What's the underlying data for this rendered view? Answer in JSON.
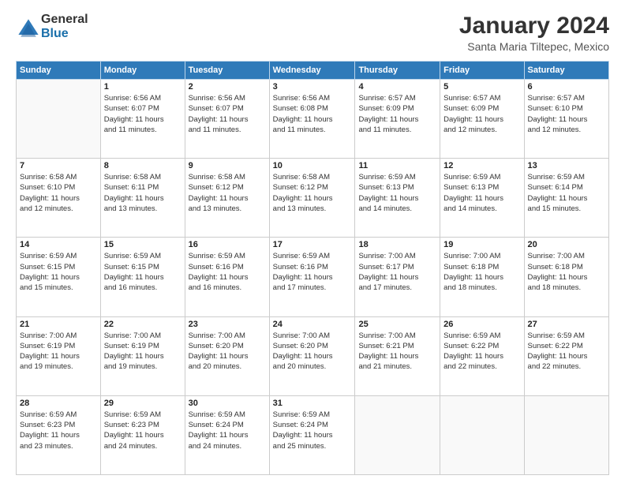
{
  "logo": {
    "general": "General",
    "blue": "Blue"
  },
  "title": "January 2024",
  "location": "Santa Maria Tiltepec, Mexico",
  "days_of_week": [
    "Sunday",
    "Monday",
    "Tuesday",
    "Wednesday",
    "Thursday",
    "Friday",
    "Saturday"
  ],
  "weeks": [
    [
      {
        "day": "",
        "info": ""
      },
      {
        "day": "1",
        "info": "Sunrise: 6:56 AM\nSunset: 6:07 PM\nDaylight: 11 hours\nand 11 minutes."
      },
      {
        "day": "2",
        "info": "Sunrise: 6:56 AM\nSunset: 6:07 PM\nDaylight: 11 hours\nand 11 minutes."
      },
      {
        "day": "3",
        "info": "Sunrise: 6:56 AM\nSunset: 6:08 PM\nDaylight: 11 hours\nand 11 minutes."
      },
      {
        "day": "4",
        "info": "Sunrise: 6:57 AM\nSunset: 6:09 PM\nDaylight: 11 hours\nand 11 minutes."
      },
      {
        "day": "5",
        "info": "Sunrise: 6:57 AM\nSunset: 6:09 PM\nDaylight: 11 hours\nand 12 minutes."
      },
      {
        "day": "6",
        "info": "Sunrise: 6:57 AM\nSunset: 6:10 PM\nDaylight: 11 hours\nand 12 minutes."
      }
    ],
    [
      {
        "day": "7",
        "info": "Sunrise: 6:58 AM\nSunset: 6:10 PM\nDaylight: 11 hours\nand 12 minutes."
      },
      {
        "day": "8",
        "info": "Sunrise: 6:58 AM\nSunset: 6:11 PM\nDaylight: 11 hours\nand 13 minutes."
      },
      {
        "day": "9",
        "info": "Sunrise: 6:58 AM\nSunset: 6:12 PM\nDaylight: 11 hours\nand 13 minutes."
      },
      {
        "day": "10",
        "info": "Sunrise: 6:58 AM\nSunset: 6:12 PM\nDaylight: 11 hours\nand 13 minutes."
      },
      {
        "day": "11",
        "info": "Sunrise: 6:59 AM\nSunset: 6:13 PM\nDaylight: 11 hours\nand 14 minutes."
      },
      {
        "day": "12",
        "info": "Sunrise: 6:59 AM\nSunset: 6:13 PM\nDaylight: 11 hours\nand 14 minutes."
      },
      {
        "day": "13",
        "info": "Sunrise: 6:59 AM\nSunset: 6:14 PM\nDaylight: 11 hours\nand 15 minutes."
      }
    ],
    [
      {
        "day": "14",
        "info": "Sunrise: 6:59 AM\nSunset: 6:15 PM\nDaylight: 11 hours\nand 15 minutes."
      },
      {
        "day": "15",
        "info": "Sunrise: 6:59 AM\nSunset: 6:15 PM\nDaylight: 11 hours\nand 16 minutes."
      },
      {
        "day": "16",
        "info": "Sunrise: 6:59 AM\nSunset: 6:16 PM\nDaylight: 11 hours\nand 16 minutes."
      },
      {
        "day": "17",
        "info": "Sunrise: 6:59 AM\nSunset: 6:16 PM\nDaylight: 11 hours\nand 17 minutes."
      },
      {
        "day": "18",
        "info": "Sunrise: 7:00 AM\nSunset: 6:17 PM\nDaylight: 11 hours\nand 17 minutes."
      },
      {
        "day": "19",
        "info": "Sunrise: 7:00 AM\nSunset: 6:18 PM\nDaylight: 11 hours\nand 18 minutes."
      },
      {
        "day": "20",
        "info": "Sunrise: 7:00 AM\nSunset: 6:18 PM\nDaylight: 11 hours\nand 18 minutes."
      }
    ],
    [
      {
        "day": "21",
        "info": "Sunrise: 7:00 AM\nSunset: 6:19 PM\nDaylight: 11 hours\nand 19 minutes."
      },
      {
        "day": "22",
        "info": "Sunrise: 7:00 AM\nSunset: 6:19 PM\nDaylight: 11 hours\nand 19 minutes."
      },
      {
        "day": "23",
        "info": "Sunrise: 7:00 AM\nSunset: 6:20 PM\nDaylight: 11 hours\nand 20 minutes."
      },
      {
        "day": "24",
        "info": "Sunrise: 7:00 AM\nSunset: 6:20 PM\nDaylight: 11 hours\nand 20 minutes."
      },
      {
        "day": "25",
        "info": "Sunrise: 7:00 AM\nSunset: 6:21 PM\nDaylight: 11 hours\nand 21 minutes."
      },
      {
        "day": "26",
        "info": "Sunrise: 6:59 AM\nSunset: 6:22 PM\nDaylight: 11 hours\nand 22 minutes."
      },
      {
        "day": "27",
        "info": "Sunrise: 6:59 AM\nSunset: 6:22 PM\nDaylight: 11 hours\nand 22 minutes."
      }
    ],
    [
      {
        "day": "28",
        "info": "Sunrise: 6:59 AM\nSunset: 6:23 PM\nDaylight: 11 hours\nand 23 minutes."
      },
      {
        "day": "29",
        "info": "Sunrise: 6:59 AM\nSunset: 6:23 PM\nDaylight: 11 hours\nand 24 minutes."
      },
      {
        "day": "30",
        "info": "Sunrise: 6:59 AM\nSunset: 6:24 PM\nDaylight: 11 hours\nand 24 minutes."
      },
      {
        "day": "31",
        "info": "Sunrise: 6:59 AM\nSunset: 6:24 PM\nDaylight: 11 hours\nand 25 minutes."
      },
      {
        "day": "",
        "info": ""
      },
      {
        "day": "",
        "info": ""
      },
      {
        "day": "",
        "info": ""
      }
    ]
  ]
}
